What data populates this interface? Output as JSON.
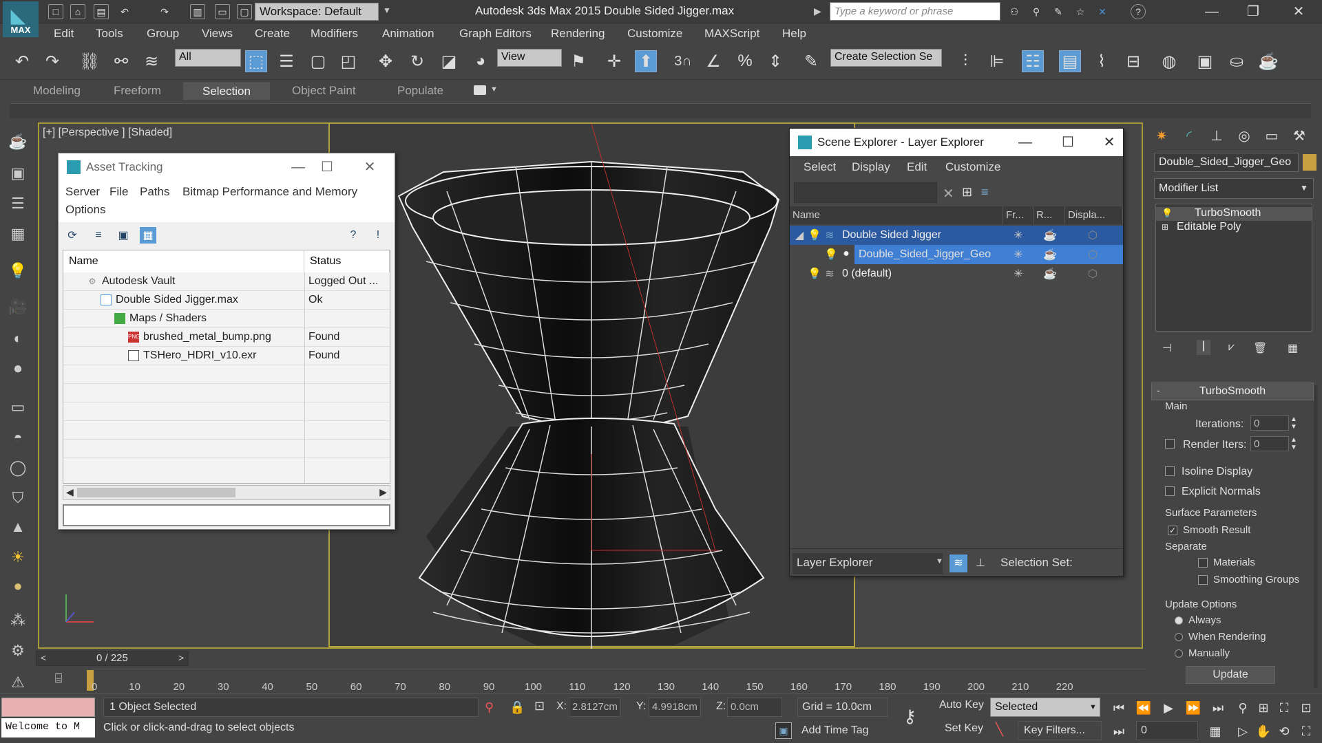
{
  "app": {
    "logo_text": "MAX",
    "workspace": "Workspace: Default",
    "title": "Autodesk 3ds Max  2015    Double Sided Jigger.max",
    "search_placeholder": "Type a keyword or phrase"
  },
  "menu": [
    "Edit",
    "Tools",
    "Group",
    "Views",
    "Create",
    "Modifiers",
    "Animation",
    "Graph Editors",
    "Rendering",
    "Customize",
    "MAXScript",
    "Help"
  ],
  "toolbar": {
    "filter": "All",
    "ref_coord": "View",
    "selection_set_placeholder": "Create Selection Se",
    "snap_label": "3"
  },
  "ribbon_tabs": [
    "Modeling",
    "Freeform",
    "Selection",
    "Object Paint",
    "Populate"
  ],
  "viewport": {
    "label": "[+] [Perspective ] [Shaded]"
  },
  "asset_tracking": {
    "title": "Asset Tracking",
    "menus": [
      "Server",
      "File",
      "Paths",
      "Bitmap Performance and Memory",
      "Options"
    ],
    "columns": [
      "Name",
      "Status"
    ],
    "rows": [
      {
        "name": "Autodesk Vault",
        "status": "Logged Out ..."
      },
      {
        "name": "Double Sided Jigger.max",
        "status": "Ok"
      },
      {
        "name": "Maps / Shaders",
        "status": ""
      },
      {
        "name": "brushed_metal_bump.png",
        "status": "Found"
      },
      {
        "name": "TSHero_HDRI_v10.exr",
        "status": "Found"
      }
    ]
  },
  "scene_explorer": {
    "title": "Scene Explorer - Layer Explorer",
    "menus": [
      "Select",
      "Display",
      "Edit",
      "Customize"
    ],
    "columns": [
      "Name",
      "Fr...",
      "R...",
      "Displa..."
    ],
    "rows": [
      {
        "name": "Double Sided Jigger"
      },
      {
        "name": "Double_Sided_Jigger_Geo"
      },
      {
        "name": "0 (default)"
      }
    ],
    "bottom_dropdown": "Layer Explorer",
    "selection_set_label": "Selection Set:"
  },
  "command_panel": {
    "object_name": "Double_Sided_Jigger_Geo",
    "modifier_list": "Modifier List",
    "stack": [
      "TurboSmooth",
      "Editable Poly"
    ],
    "rollout_title": "TurboSmooth",
    "main_label": "Main",
    "iterations_label": "Iterations:",
    "iterations_value": "0",
    "render_iters_label": "Render Iters:",
    "render_iters_value": "0",
    "isoline": "Isoline Display",
    "explicit_normals": "Explicit Normals",
    "surface_params": "Surface Parameters",
    "smooth_result": "Smooth Result",
    "separate": "Separate",
    "materials": "Materials",
    "smoothing_groups": "Smoothing Groups",
    "update_options": "Update Options",
    "always": "Always",
    "when_rendering": "When Rendering",
    "manually": "Manually",
    "update_button": "Update"
  },
  "timeline": {
    "frame_label": "0 / 225",
    "ticks": [
      "0",
      "10",
      "20",
      "30",
      "40",
      "50",
      "60",
      "70",
      "80",
      "90",
      "100",
      "110",
      "120",
      "130",
      "140",
      "150",
      "160",
      "170",
      "180",
      "190",
      "200",
      "210",
      "220"
    ]
  },
  "status": {
    "welcome": "Welcome to M",
    "objects_selected": "1 Object Selected",
    "prompt": "Click or click-and-drag to select objects",
    "x_label": "X:",
    "x_value": "2.8127cm",
    "y_label": "Y:",
    "y_value": "4.9918cm",
    "z_label": "Z:",
    "z_value": "0.0cm",
    "grid": "Grid = 10.0cm",
    "add_time_tag": "Add Time Tag",
    "auto_key": "Auto Key",
    "set_key": "Set Key",
    "key_mode": "Selected",
    "key_filters": "Key Filters...",
    "current_frame": "0"
  }
}
